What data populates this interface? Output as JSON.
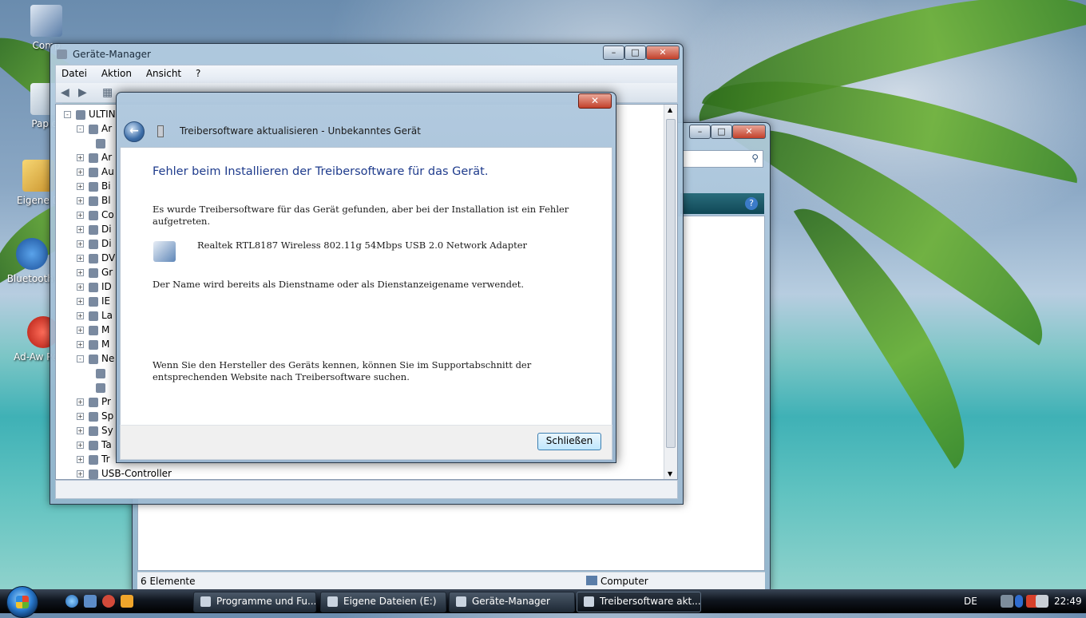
{
  "desktop": {
    "icons": [
      {
        "label": "Comp"
      },
      {
        "label": "Papier"
      },
      {
        "label": "Eigene D"
      },
      {
        "label": "Bluetooth-"
      },
      {
        "label": "Ad-Aw Perso"
      }
    ]
  },
  "controlpanel_window": {
    "statusbar_left": "6 Elemente",
    "statusbar_right": "Computer"
  },
  "devmgr_window": {
    "title": "Geräte-Manager",
    "menu": [
      "Datei",
      "Aktion",
      "Ansicht",
      "?"
    ],
    "tree": [
      {
        "label": "ULTIN",
        "expander": "-"
      },
      {
        "label": "Ar",
        "expander": "-"
      },
      {
        "label": "",
        "expander": ""
      },
      {
        "label": "Ar",
        "expander": "+"
      },
      {
        "label": "Au",
        "expander": "+"
      },
      {
        "label": "Bi",
        "expander": "+"
      },
      {
        "label": "Bl",
        "expander": "+"
      },
      {
        "label": "Co",
        "expander": "+"
      },
      {
        "label": "Di",
        "expander": "+"
      },
      {
        "label": "Di",
        "expander": "+"
      },
      {
        "label": "DV",
        "expander": "+"
      },
      {
        "label": "Gr",
        "expander": "+"
      },
      {
        "label": "ID",
        "expander": "+"
      },
      {
        "label": "IE",
        "expander": "+"
      },
      {
        "label": "La",
        "expander": "+"
      },
      {
        "label": "M",
        "expander": "+"
      },
      {
        "label": "M",
        "expander": "+"
      },
      {
        "label": "Ne",
        "expander": "-"
      },
      {
        "label": "",
        "expander": ""
      },
      {
        "label": "",
        "expander": ""
      },
      {
        "label": "Pr",
        "expander": "+"
      },
      {
        "label": "Sp",
        "expander": "+"
      },
      {
        "label": "Sy",
        "expander": "+"
      },
      {
        "label": "Ta",
        "expander": "+"
      },
      {
        "label": "Tr",
        "expander": "+"
      },
      {
        "label": "USB-Controller",
        "expander": "+"
      }
    ]
  },
  "dialog": {
    "header_title": "Treibersoftware aktualisieren - Unbekanntes Gerät",
    "error_heading": "Fehler beim Installieren der Treibersoftware für das Gerät.",
    "intro_line1": "Es wurde Treibersoftware für das Gerät gefunden, aber bei der Installation ist ein Fehler",
    "intro_line2": "aufgetreten.",
    "device_name": "Realtek RTL8187 Wireless 802.11g 54Mbps USB 2.0 Network Adapter",
    "error_detail": "Der Name wird bereits als Dienstname oder als Dienstanzeigename verwendet.",
    "hint_line1": "Wenn Sie den Hersteller des Geräts kennen, können Sie im Supportabschnitt der",
    "hint_line2": "entsprechenden Website nach Treibersoftware suchen.",
    "close_button": "Schließen",
    "close_x": "x"
  },
  "taskbar": {
    "tasks": [
      {
        "label": "Programme und Fu..."
      },
      {
        "label": "Eigene Dateien (E:)"
      },
      {
        "label": "Geräte-Manager"
      },
      {
        "label": "Treibersoftware akt..."
      }
    ],
    "language": "DE",
    "clock": "22:49"
  },
  "colors": {
    "heading_blue": "#1e3b8c",
    "close_red": "#c2402a",
    "taskbar_black": "#10161f"
  }
}
